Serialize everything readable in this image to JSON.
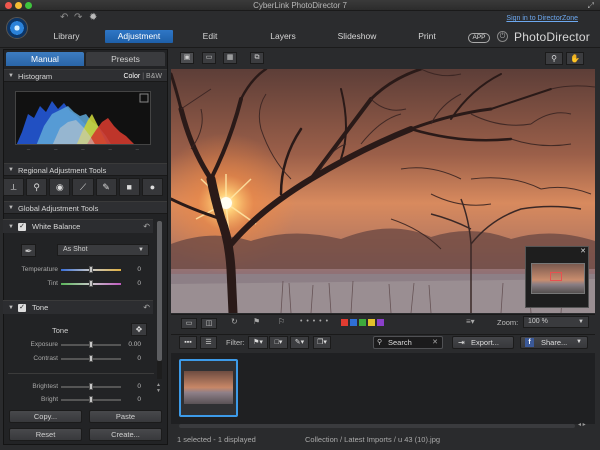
{
  "window": {
    "title": "CyberLink PhotoDirector 7"
  },
  "header": {
    "tabs": [
      "Library",
      "Adjustment",
      "Edit",
      "Layers",
      "Slideshow",
      "Print"
    ],
    "active_tab": "Adjustment",
    "signin": "Sign in to DirectorZone",
    "app_badge": "APP",
    "brand": "PhotoDirector"
  },
  "left_panel": {
    "tabs": {
      "manual": "Manual",
      "presets": "Presets"
    },
    "histogram": {
      "title": "Histogram",
      "color": "Color",
      "bw": "B&W"
    },
    "regional": {
      "title": "Regional Adjustment Tools"
    },
    "global": {
      "title": "Global Adjustment Tools"
    },
    "white_balance": {
      "title": "White Balance",
      "preset": "As Shot",
      "sliders": [
        {
          "label": "Temperature",
          "value": "0",
          "level": 0.5
        },
        {
          "label": "Tint",
          "value": "0",
          "level": 0.5
        }
      ]
    },
    "tone": {
      "title": "Tone",
      "sub_label": "Tone",
      "sliders": [
        {
          "label": "Exposure",
          "value": "0.00",
          "level": 0.5
        },
        {
          "label": "Contrast",
          "value": "0",
          "level": 0.5
        },
        {
          "label": "Brightest",
          "value": "0",
          "level": 0.5
        },
        {
          "label": "Bright",
          "value": "0",
          "level": 0.5
        }
      ]
    },
    "buttons": {
      "copy": "Copy...",
      "paste": "Paste",
      "reset": "Reset",
      "create": "Create..."
    }
  },
  "main": {
    "zoom_label": "Zoom:",
    "zoom_value": "100 %",
    "filter_label": "Filter:",
    "search_value": "Search",
    "export_label": "Export...",
    "share_label": "Share...",
    "color_labels": [
      "#e03c31",
      "#2f6fd6",
      "#3daa3d",
      "#e3c12b",
      "#8a3fc9"
    ]
  },
  "status": {
    "selection": "1 selected - 1 displayed",
    "path": "Collection / Latest Imports / u 43 (10).jpg"
  }
}
